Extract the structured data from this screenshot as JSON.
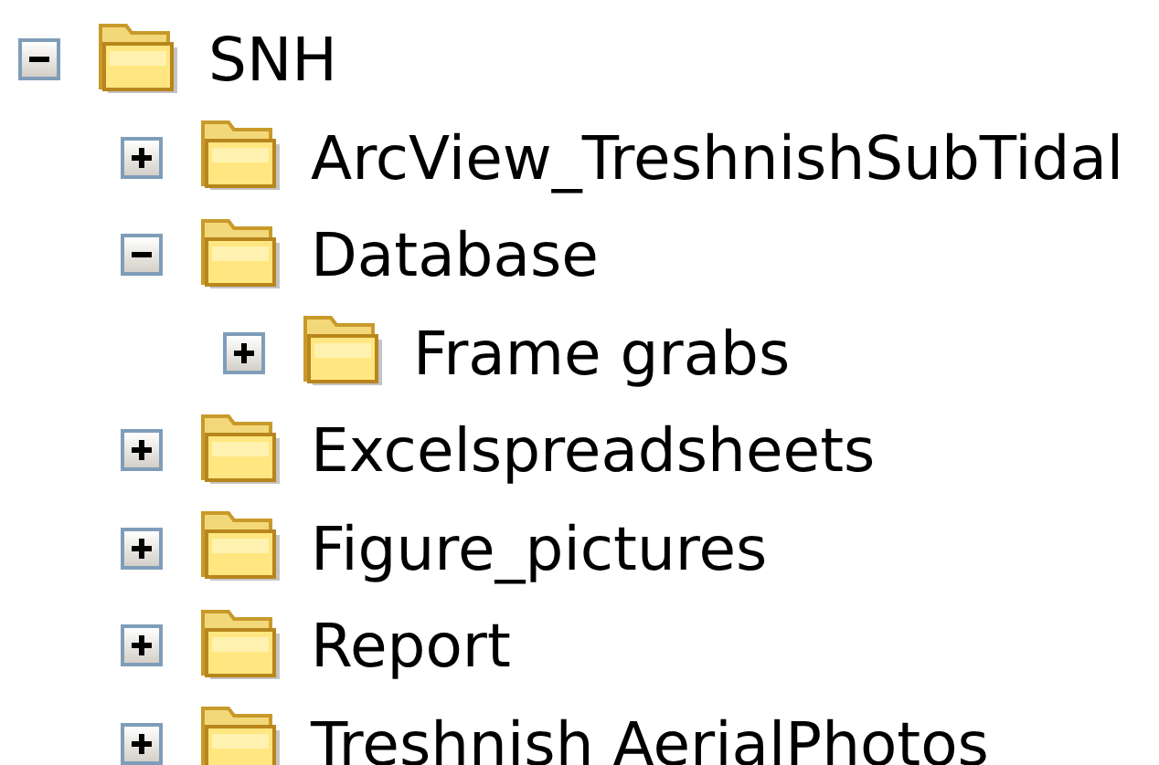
{
  "tree": [
    {
      "label": "SNH",
      "expanded": true,
      "children": [
        {
          "label": "ArcView_TreshnishSubTidal",
          "expanded": false
        },
        {
          "label": "Database",
          "expanded": true,
          "children": [
            {
              "label": "Frame grabs",
              "expanded": false
            }
          ]
        },
        {
          "label": "Excelspreadsheets",
          "expanded": false
        },
        {
          "label": "Figure_pictures",
          "expanded": false
        },
        {
          "label": "Report",
          "expanded": false
        },
        {
          "label": "Treshnish AerialPhotos",
          "expanded": false
        }
      ]
    }
  ]
}
